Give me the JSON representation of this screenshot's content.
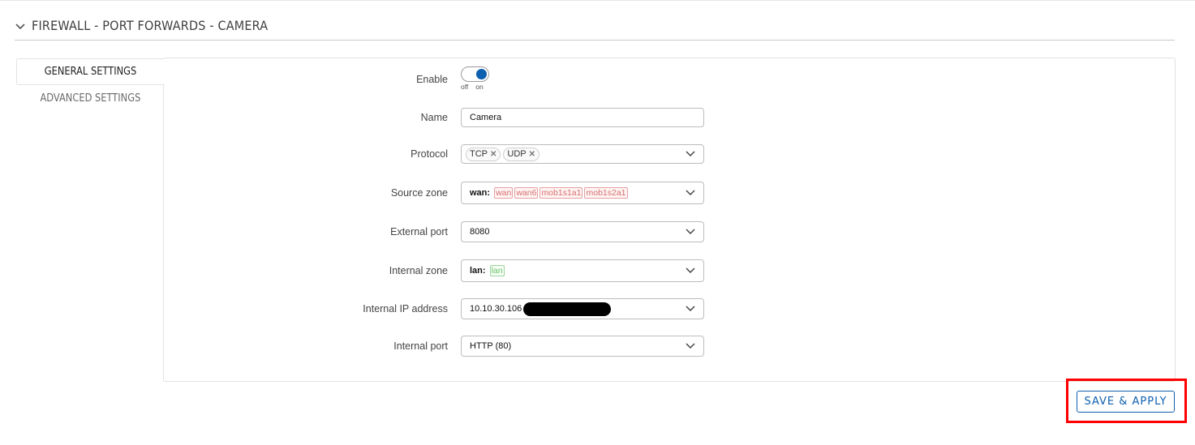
{
  "section": {
    "title": "FIREWALL - PORT FORWARDS - CAMERA"
  },
  "tabs": [
    {
      "label": "GENERAL SETTINGS",
      "active": true
    },
    {
      "label": "ADVANCED SETTINGS",
      "active": false
    }
  ],
  "form": {
    "enable": {
      "label": "Enable",
      "value": true,
      "off_text": "off",
      "on_text": "on"
    },
    "name": {
      "label": "Name",
      "value": "Camera"
    },
    "protocol": {
      "label": "Protocol",
      "selected": [
        "TCP",
        "UDP"
      ]
    },
    "source_zone": {
      "label": "Source zone",
      "key": "wan:",
      "networks": [
        "wan",
        "wan6",
        "mob1s1a1",
        "mob1s2a1"
      ]
    },
    "external_port": {
      "label": "External port",
      "value": "8080"
    },
    "internal_zone": {
      "label": "Internal zone",
      "key": "lan:",
      "networks": [
        "lan"
      ]
    },
    "internal_ip": {
      "label": "Internal IP address",
      "value": "10.10.30.106"
    },
    "internal_port": {
      "label": "Internal port",
      "value": "HTTP (80)"
    }
  },
  "actions": {
    "save_apply_label": "SAVE & APPLY"
  },
  "colors": {
    "accent": "#0d5fb0",
    "zone_wan": "#d76c6c",
    "zone_lan": "#6bbf6b",
    "highlight": "#ff0000"
  }
}
